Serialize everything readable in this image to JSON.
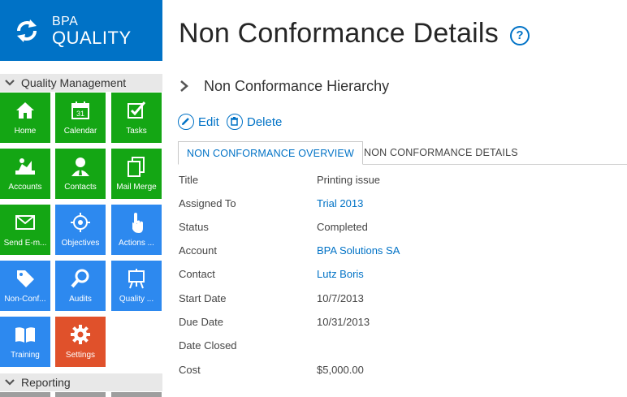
{
  "brand": {
    "line1": "BPA",
    "line2": "QUALITY",
    "logo_icon": "refresh-arrows-icon",
    "color": "#0072c6"
  },
  "sidebar": {
    "section1": "Quality Management",
    "section2": "Reporting",
    "tiles": [
      {
        "label": "Home",
        "icon": "home-icon",
        "color": "#14a614"
      },
      {
        "label": "Calendar",
        "icon": "calendar-icon",
        "color": "#14a614",
        "badge": "31"
      },
      {
        "label": "Tasks",
        "icon": "tasks-icon",
        "color": "#14a614"
      },
      {
        "label": "Accounts",
        "icon": "accounts-icon",
        "color": "#14a614"
      },
      {
        "label": "Contacts",
        "icon": "contacts-icon",
        "color": "#14a614"
      },
      {
        "label": "Mail Merge",
        "icon": "mail-merge-icon",
        "color": "#14a614"
      },
      {
        "label": "Send E-m...",
        "icon": "envelope-icon",
        "color": "#14a614"
      },
      {
        "label": "Objectives",
        "icon": "target-icon",
        "color": "#2d89ef"
      },
      {
        "label": "Actions ...",
        "icon": "pointer-hand-icon",
        "color": "#2d89ef"
      },
      {
        "label": "Non-Conf...",
        "icon": "tag-icon",
        "color": "#2d89ef"
      },
      {
        "label": "Audits",
        "icon": "magnifier-icon",
        "color": "#2d89ef"
      },
      {
        "label": "Quality ...",
        "icon": "easel-icon",
        "color": "#2d89ef"
      },
      {
        "label": "Training",
        "icon": "book-icon",
        "color": "#2d89ef"
      },
      {
        "label": "Settings",
        "icon": "gear-icon",
        "color": "#e0512b"
      }
    ]
  },
  "main": {
    "title": "Non Conformance Details",
    "help": "?",
    "hierarchy": "Non Conformance Hierarchy",
    "actions": {
      "edit": "Edit",
      "delete": "Delete"
    },
    "tabs": [
      "NON CONFORMANCE OVERVIEW",
      "NON CONFORMANCE DETAILS"
    ],
    "fields": [
      {
        "label": "Title",
        "value": "Printing issue",
        "link": false
      },
      {
        "label": "Assigned To",
        "value": "Trial 2013",
        "link": true
      },
      {
        "label": "Status",
        "value": "Completed",
        "link": false
      },
      {
        "label": "Account",
        "value": "BPA Solutions SA",
        "link": true
      },
      {
        "label": "Contact",
        "value": "Lutz Boris",
        "link": true
      },
      {
        "label": "Start Date",
        "value": "10/7/2013",
        "link": false
      },
      {
        "label": "Due Date",
        "value": "10/31/2013",
        "link": false
      },
      {
        "label": "Date Closed",
        "value": "",
        "link": false
      },
      {
        "label": "Cost",
        "value": "$5,000.00",
        "link": false
      }
    ]
  }
}
